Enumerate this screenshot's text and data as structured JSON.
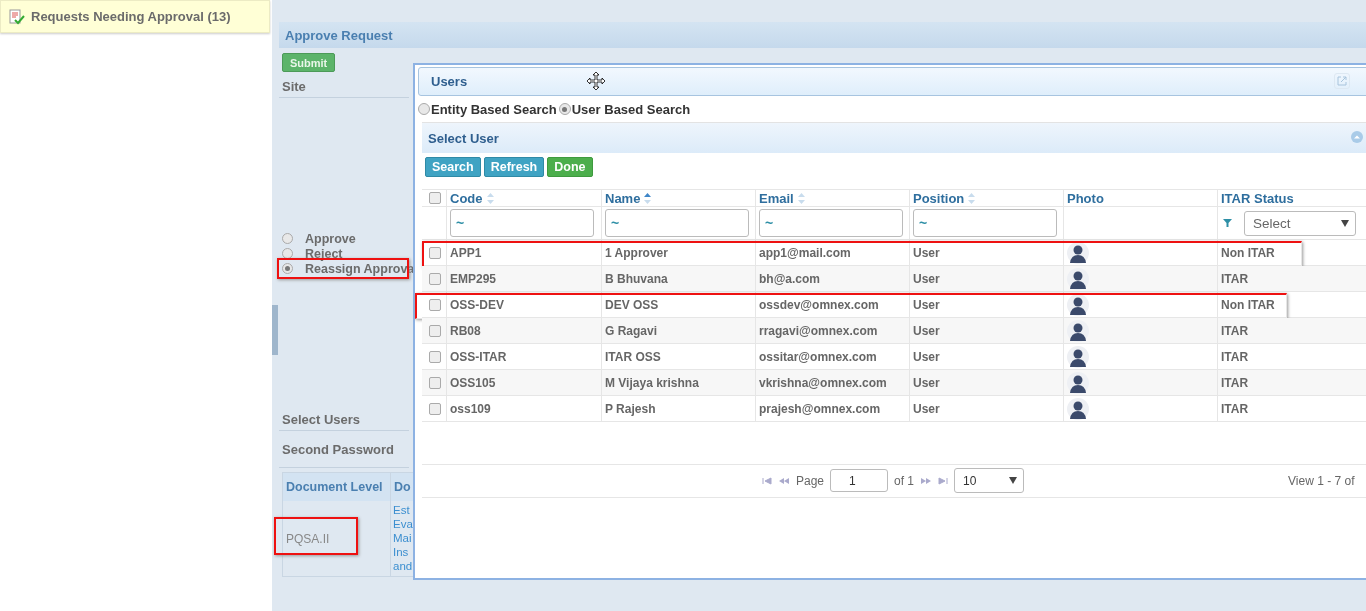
{
  "sidebar_header": {
    "title": "Requests Needing Approval (13)"
  },
  "form": {
    "title": "Approve Request",
    "submit": "Submit",
    "site_label": "Site",
    "actions": [
      {
        "label": "Approve",
        "selected": false,
        "highlighted": false
      },
      {
        "label": "Reject",
        "selected": false,
        "highlighted": false
      },
      {
        "label": "Reassign Approva",
        "selected": true,
        "highlighted": true
      }
    ],
    "select_users_label": "Select Users",
    "second_password_label": "Second Password",
    "documents": {
      "columns": [
        "Document Level",
        "Do"
      ],
      "rows": [
        {
          "level": "PQSA.II",
          "highlighted": true,
          "description_lines": [
            "Est",
            "Eva",
            "Mai",
            "Ins",
            "and"
          ]
        }
      ]
    }
  },
  "dialog": {
    "title": "Users",
    "search_modes": [
      {
        "label": "Entity Based Search",
        "selected": false
      },
      {
        "label": "User Based Search",
        "selected": true
      }
    ],
    "section_title": "Select User",
    "buttons": [
      {
        "label": "Search",
        "kind": "info"
      },
      {
        "label": "Refresh",
        "kind": "info"
      },
      {
        "label": "Done",
        "kind": "success"
      }
    ],
    "select_all_checked": false,
    "columns": [
      {
        "label": "Code",
        "sortable": true,
        "sorted": false,
        "kind": "text",
        "filter_value": "~"
      },
      {
        "label": "Name",
        "sortable": true,
        "sorted": true,
        "kind": "text",
        "filter_value": "~"
      },
      {
        "label": "Email",
        "sortable": true,
        "sorted": false,
        "kind": "text",
        "filter_value": "~"
      },
      {
        "label": "Position",
        "sortable": true,
        "sorted": false,
        "kind": "text",
        "filter_value": "~"
      },
      {
        "label": "Photo",
        "sortable": false,
        "kind": "photo"
      },
      {
        "label": "ITAR Status",
        "sortable": false,
        "kind": "select",
        "filter_value": "Select"
      }
    ],
    "rows": [
      {
        "code": "APP1",
        "name": "1 Approver",
        "email": "app1@mail.com",
        "position": "User",
        "itar": "Non ITAR",
        "checked": false,
        "highlighted": true
      },
      {
        "code": "EMP295",
        "name": "B Bhuvana",
        "email": "bh@a.com",
        "position": "User",
        "itar": "ITAR",
        "checked": false,
        "highlighted": false
      },
      {
        "code": "OSS-DEV",
        "name": "DEV OSS",
        "email": "ossdev@omnex.com",
        "position": "User",
        "itar": "Non ITAR",
        "checked": false,
        "highlighted": true
      },
      {
        "code": "RB08",
        "name": "G Ragavi",
        "email": "rragavi@omnex.com",
        "position": "User",
        "itar": "ITAR",
        "checked": false,
        "highlighted": false
      },
      {
        "code": "OSS-ITAR",
        "name": "ITAR OSS",
        "email": "ossitar@omnex.com",
        "position": "User",
        "itar": "ITAR",
        "checked": false,
        "highlighted": false
      },
      {
        "code": "OSS105",
        "name": "M Vijaya krishna",
        "email": "vkrishna@omnex.com",
        "position": "User",
        "itar": "ITAR",
        "checked": false,
        "highlighted": false
      },
      {
        "code": "oss109",
        "name": "P Rajesh",
        "email": "prajesh@omnex.com",
        "position": "User",
        "itar": "ITAR",
        "checked": false,
        "highlighted": false
      }
    ],
    "pager": {
      "page_label": "Page",
      "page": "1",
      "of": "of 1",
      "page_size": "10",
      "view": "View 1 - 7 of"
    }
  }
}
